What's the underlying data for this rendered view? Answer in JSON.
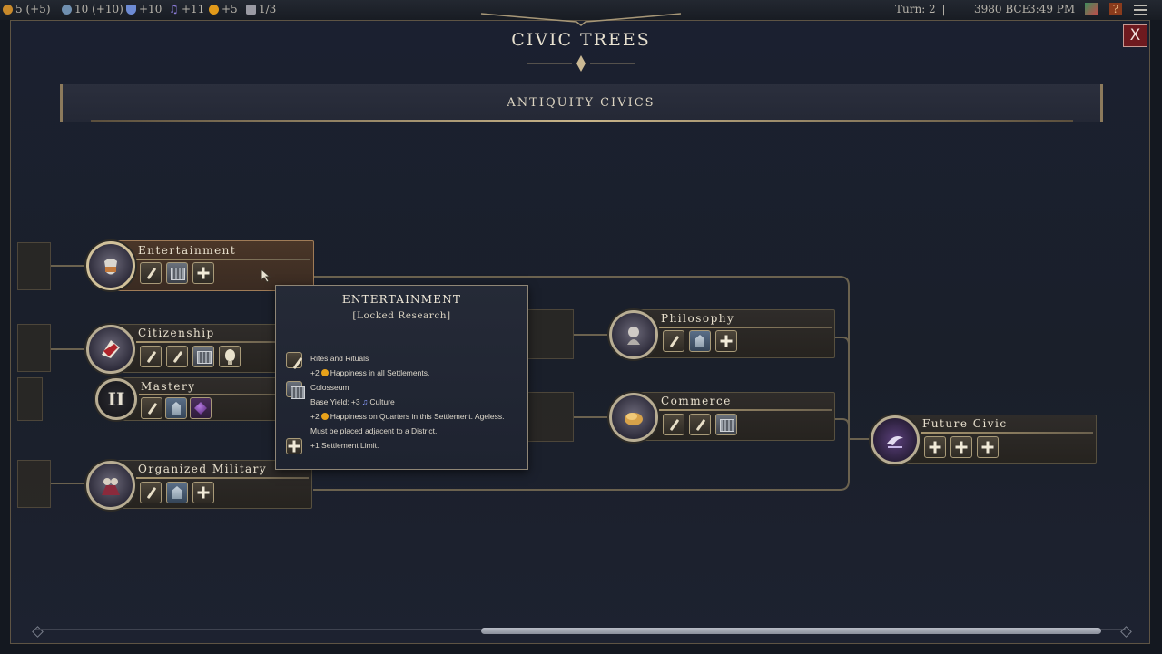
{
  "topbar": {
    "resources": [
      {
        "name": "gold",
        "value": "5 (+5)",
        "color": "#c98a2b"
      },
      {
        "name": "influence",
        "value": "10 (+10)",
        "color": "#6f8fb0"
      },
      {
        "name": "science",
        "value": "+10",
        "color": "#6d8bd4"
      },
      {
        "name": "culture",
        "value": "+11",
        "color": "#8b7bd8"
      },
      {
        "name": "happiness",
        "value": "+5",
        "color": "#e29a1a"
      },
      {
        "name": "settlements",
        "value": "1/3",
        "color": "#9a9aa3"
      }
    ],
    "turn": "Turn: 2",
    "separator": "|",
    "era_year": "3980 BCE",
    "clock": "3:49 PM"
  },
  "panel": {
    "title": "CIVIC TREES",
    "close_label": "X",
    "era_header": "ANTIQUITY CIVICS"
  },
  "nodes": {
    "entertainment": {
      "name": "Entertainment"
    },
    "citizenship": {
      "name": "Citizenship"
    },
    "mastery": {
      "name": "Mastery",
      "numeral": "II"
    },
    "organized_military": {
      "name": "Organized Military"
    },
    "philosophy": {
      "name": "Philosophy"
    },
    "commerce": {
      "name": "Commerce"
    },
    "future_civic": {
      "name": "Future Civic"
    }
  },
  "tooltip": {
    "title": "ENTERTAINMENT",
    "status": "[Locked Research]",
    "tradition_name": "Rites and Rituals",
    "tradition_effect_prefix": "+2",
    "tradition_effect_suffix": "Happiness in all Settlements.",
    "building_name": "Colosseum",
    "building_yield_prefix": "Base Yield: +3",
    "building_yield_suffix": "Culture",
    "building_effect_prefix": "+2",
    "building_effect_suffix": "Happiness on Quarters in this Settlement. Ageless.",
    "building_requirement": "Must be placed adjacent to a District.",
    "bonus": "+1 Settlement Limit."
  },
  "colors": {
    "accent_gold": "#c9b58a",
    "close_red": "#6e1a1f",
    "happiness": "#e8a21a",
    "culture": "#8a9dff"
  },
  "icons": [
    "gold-icon",
    "influence-icon",
    "science-icon",
    "culture-icon",
    "happiness-icon",
    "settlement-icon",
    "leader-icon",
    "help-icon",
    "menu-icon",
    "close-icon",
    "tradition-icon",
    "building-icon",
    "wonder-icon",
    "plus-icon",
    "gem-icon",
    "bulb-icon"
  ]
}
